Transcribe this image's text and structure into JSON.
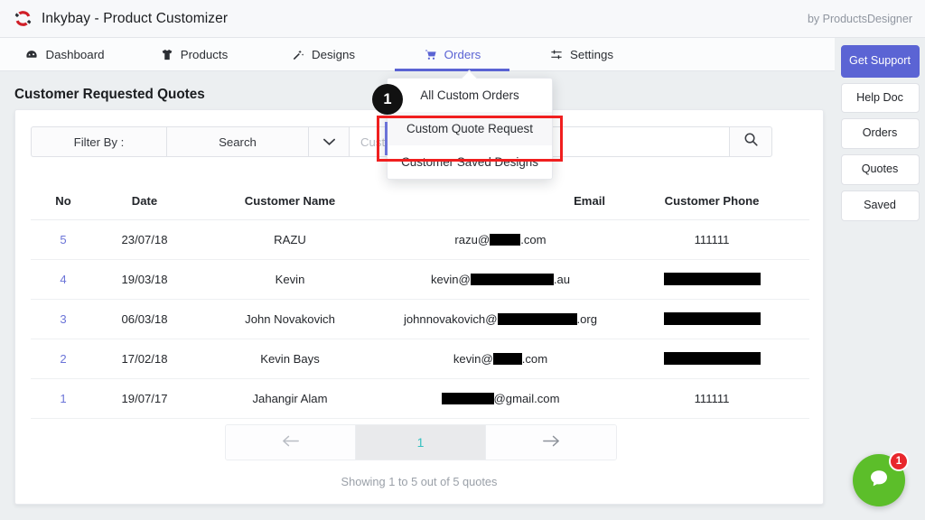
{
  "header": {
    "brand_title": "Inkybay - Product Customizer",
    "logo_icon": "inkybay-swirl-logo",
    "by_line": "by ProductsDesigner"
  },
  "nav": {
    "tabs": [
      {
        "label": "Dashboard",
        "icon": "speedometer-icon",
        "active": false
      },
      {
        "label": "Products",
        "icon": "tshirt-icon",
        "active": false
      },
      {
        "label": "Designs",
        "icon": "magic-wand-icon",
        "active": false
      },
      {
        "label": "Orders",
        "icon": "shopping-cart-icon",
        "active": true
      },
      {
        "label": "Settings",
        "icon": "sliders-icon",
        "active": false
      }
    ],
    "active_color": "#5b64d4"
  },
  "dropdown": {
    "open": true,
    "items": [
      {
        "label": "All Custom Orders",
        "hovered": false
      },
      {
        "label": "Custom Quote Request",
        "hovered": true
      },
      {
        "label": "Customer Saved Designs",
        "hovered": false
      }
    ]
  },
  "rail": {
    "buttons": [
      {
        "label": "Get Support",
        "primary": true
      },
      {
        "label": "Help Doc",
        "primary": false
      },
      {
        "label": "Orders",
        "primary": false
      },
      {
        "label": "Quotes",
        "primary": false
      },
      {
        "label": "Saved",
        "primary": false
      }
    ]
  },
  "page": {
    "title": "Customer Requested Quotes"
  },
  "search": {
    "filter_label": "Filter By :",
    "search_label": "Search",
    "caret_icon": "chevron-down-icon",
    "input_value": "",
    "placeholder": "Customer Name",
    "button_icon": "search-icon"
  },
  "table": {
    "columns": [
      "No",
      "Date",
      "Customer Name",
      "Email",
      "Customer Phone"
    ],
    "rows": [
      {
        "no": "5",
        "date": "23/07/18",
        "name": "RAZU",
        "email_prefix": "razu@",
        "email_redact_w": 34,
        "email_suffix": ".com",
        "phone": "111111",
        "phone_redact_w": 0
      },
      {
        "no": "4",
        "date": "19/03/18",
        "name": "Kevin",
        "email_prefix": "kevin@",
        "email_redact_w": 92,
        "email_suffix": ".au",
        "phone": "",
        "phone_redact_w": 107
      },
      {
        "no": "3",
        "date": "06/03/18",
        "name": "John Novakovich",
        "email_prefix": "johnnovakovich@",
        "email_redact_w": 88,
        "email_suffix": ".org",
        "phone": "",
        "phone_redact_w": 107
      },
      {
        "no": "2",
        "date": "17/02/18",
        "name": "Kevin Bays",
        "email_prefix": "kevin@",
        "email_redact_w": 32,
        "email_suffix": ".com",
        "phone": "",
        "phone_redact_w": 107
      },
      {
        "no": "1",
        "date": "19/07/17",
        "name": "Jahangir Alam",
        "email_prefix": "",
        "email_redact_w": 58,
        "email_suffix": "@gmail.com",
        "phone": "111111",
        "phone_redact_w": 0
      }
    ]
  },
  "pagination": {
    "prev_icon": "arrow-left-icon",
    "current_page": "1",
    "next_icon": "arrow-right-icon",
    "showing_text": "Showing 1 to 5 out of 5 quotes",
    "current_color": "#35c0c0"
  },
  "annotation": {
    "step_number": "1",
    "box_color": "#f01f1f"
  },
  "chat": {
    "icon": "chat-bubble-icon",
    "badge": "1",
    "bubble_color": "#5cbe2a",
    "badge_color": "#e8272c"
  }
}
